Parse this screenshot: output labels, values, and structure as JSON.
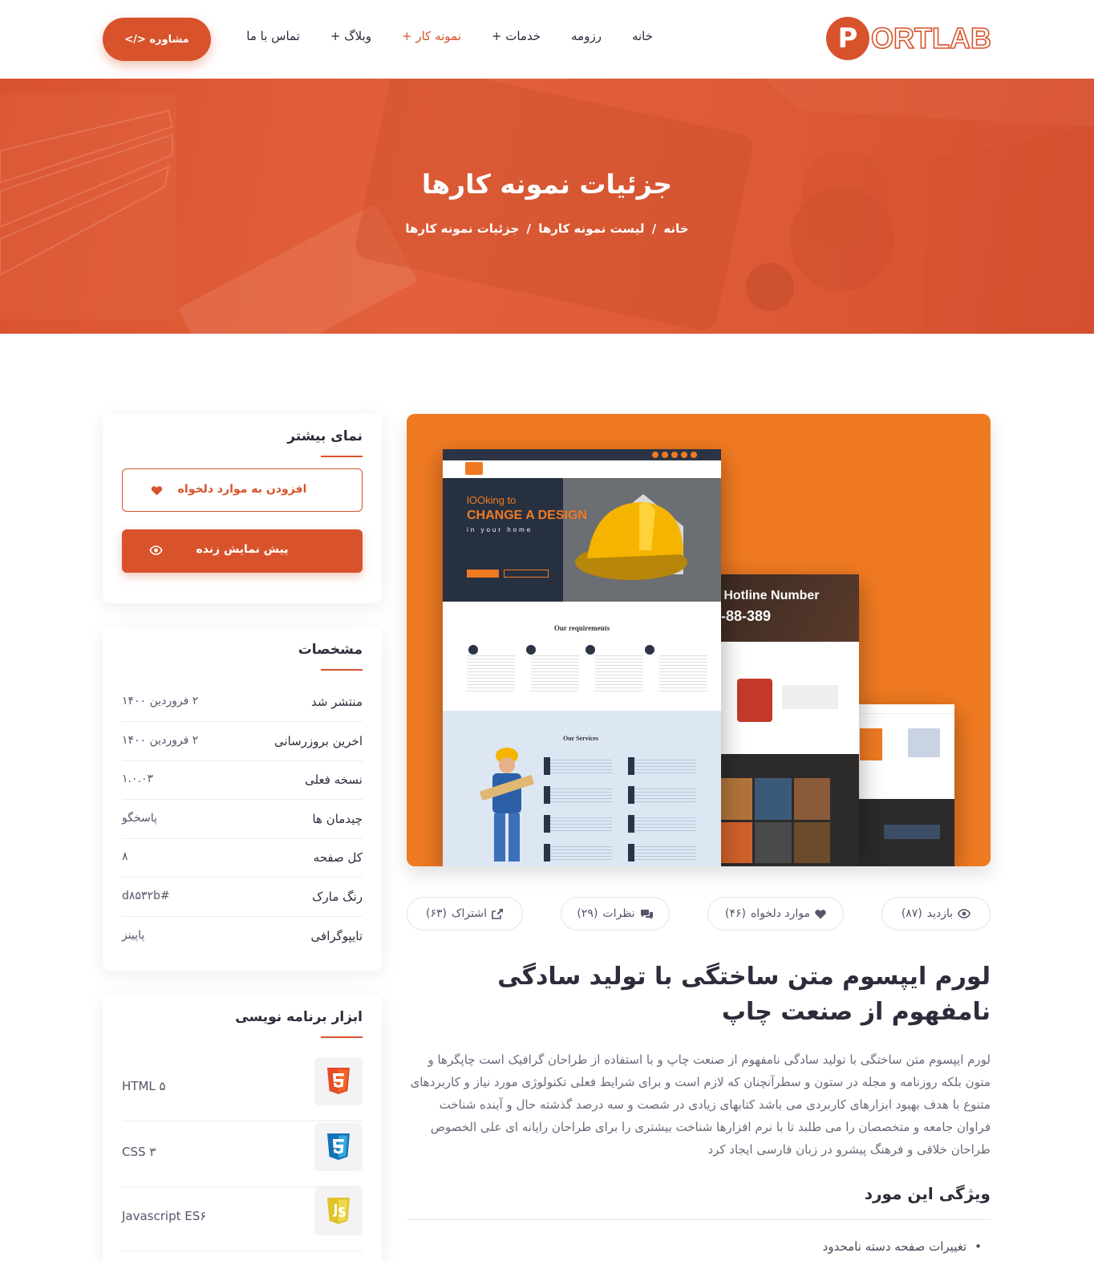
{
  "header": {
    "logo_letter": "P",
    "logo_word": "ORTLAB",
    "nav": [
      {
        "label": "خانه"
      },
      {
        "label": "رزومه"
      },
      {
        "label": "خدمات +"
      },
      {
        "label": "نمونه کار +"
      },
      {
        "label": "وبلاگ +"
      },
      {
        "label": "تماس با ما"
      }
    ],
    "consult_button": "مشاوره </>",
    "accent_color": "#d8532b"
  },
  "hero": {
    "title": "جزئیات نمونه کارها",
    "breadcrumb": [
      "خانه",
      "لیست نمونه کارها",
      "جزئیات نمونه کارها"
    ],
    "separator": "/"
  },
  "mockup": {
    "hero_line1": "lOOking to",
    "hero_line2": "CHANGE A DESIGN",
    "hero_line3": "in your home",
    "requirements": "Our requirements",
    "services": "Our Services",
    "hotline": "y Hotline Number",
    "hotline_number": "2-88-389"
  },
  "stats": [
    {
      "icon": "eye-icon",
      "label": "بازدید",
      "count": "(۸۷)"
    },
    {
      "icon": "heart-icon",
      "label": "موارد دلخواه",
      "count": "(۴۶)"
    },
    {
      "icon": "comments-icon",
      "label": "نظرات",
      "count": "(۲۹)"
    },
    {
      "icon": "share-icon",
      "label": "اشتراک",
      "count": "(۶۳)"
    }
  ],
  "post": {
    "title": "لورم ایپسوم متن ساختگی با تولید سادگی نامفهوم از صنعت چاپ",
    "body": "لورم ایپسوم متن ساختگی با تولید سادگی نامفهوم از صنعت چاپ و با استفاده از طراحان گرافیک است چاپگرها و متون بلکه روزنامه و مجله در ستون و سطرآنچنان که لازم است و برای شرایط فعلی تکنولوژی مورد نیاز و کاربردهای متنوع با هدف بهبود ابزارهای کاربردی می باشد کتابهای زیادی در شصت و سه درصد گذشته حال و آینده شناخت فراوان جامعه و متخصصان را می طلبد تا با نرم افزارها شناخت بیشتری را برای طراحان رایانه ای علی الخصوص طراحان خلاقی و فرهنگ پیشرو در زبان فارسی ایجاد کرد",
    "features_title": "ویژگی این مورد",
    "features": [
      "تغییرات صفحه دسته نامحدود"
    ]
  },
  "sidebar": {
    "more_view": {
      "title": "نمای بیشتر",
      "favorite_button": "افزودن به موارد دلخواه",
      "preview_button": "پیش نمایش زنده"
    },
    "specs": {
      "title": "مشخصات",
      "rows": [
        {
          "key": "منتشر شد",
          "value": "۲ فروردین ۱۴۰۰"
        },
        {
          "key": "اخرین بروزرسانی",
          "value": "۲ فروردین ۱۴۰۰"
        },
        {
          "key": "نسخه فعلی",
          "value": "۱.۰.۰۳"
        },
        {
          "key": "چیدمان ها",
          "value": "پاسخگو"
        },
        {
          "key": "کل صفحه",
          "value": "۸"
        },
        {
          "key": "رنگ مارک",
          "value": "#d۸۵۳۲b"
        },
        {
          "key": "تایپوگرافی",
          "value": "پاپینز"
        }
      ]
    },
    "tools": {
      "title": "ابزار برنامه نویسی",
      "items": [
        {
          "name": "HTML ۵",
          "icon": "html5-icon",
          "color": "#e44d26"
        },
        {
          "name": "CSS ۳",
          "icon": "css3-icon",
          "color": "#1572b6"
        },
        {
          "name": "Javascript ES۶",
          "icon": "js-icon",
          "color": "#e0c32c"
        }
      ]
    }
  }
}
